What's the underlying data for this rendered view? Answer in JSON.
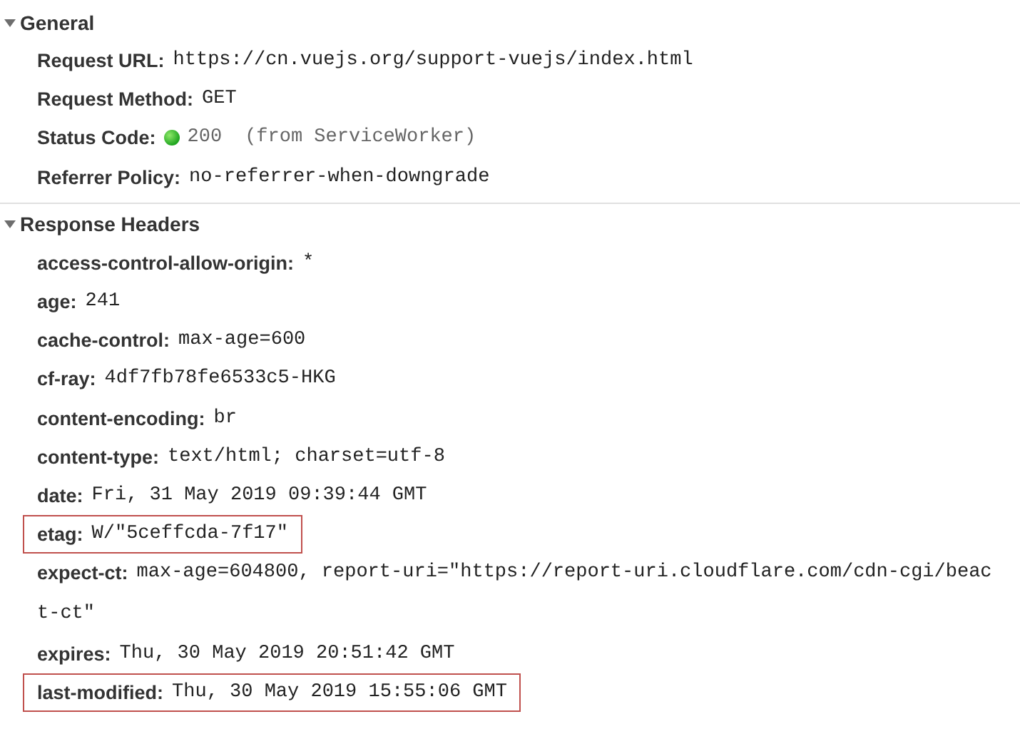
{
  "sections": [
    {
      "title": "General",
      "expanded": true,
      "rows": [
        {
          "kind": "plain",
          "name": "Request URL:",
          "value": "https://cn.vuejs.org/support-vuejs/index.html",
          "highlighted": false
        },
        {
          "kind": "plain",
          "name": "Request Method:",
          "value": "GET",
          "highlighted": false
        },
        {
          "kind": "status",
          "name": "Status Code:",
          "value": "200",
          "note": "(from ServiceWorker)",
          "highlighted": false
        },
        {
          "kind": "plain",
          "name": "Referrer Policy:",
          "value": "no-referrer-when-downgrade",
          "highlighted": false
        }
      ]
    },
    {
      "title": "Response Headers",
      "expanded": true,
      "rows": [
        {
          "kind": "plain",
          "name": "access-control-allow-origin:",
          "value": "*",
          "highlighted": false
        },
        {
          "kind": "plain",
          "name": "age:",
          "value": "241",
          "highlighted": false
        },
        {
          "kind": "plain",
          "name": "cache-control:",
          "value": "max-age=600",
          "highlighted": false
        },
        {
          "kind": "plain",
          "name": "cf-ray:",
          "value": "4df7fb78fe6533c5-HKG",
          "highlighted": false
        },
        {
          "kind": "plain",
          "name": "content-encoding:",
          "value": "br",
          "highlighted": false
        },
        {
          "kind": "plain",
          "name": "content-type:",
          "value": "text/html; charset=utf-8",
          "highlighted": false
        },
        {
          "kind": "plain",
          "name": "date:",
          "value": "Fri, 31 May 2019 09:39:44 GMT",
          "highlighted": false
        },
        {
          "kind": "plain",
          "name": "etag:",
          "value": "W/\"5ceffcda-7f17\"",
          "highlighted": true
        },
        {
          "kind": "wrapped",
          "name": "expect-ct:",
          "value": "max-age=604800, report-uri=\"https://report-uri.cloudflare.com/cdn-cgi/beac",
          "continuation": "t-ct\"",
          "highlighted": false
        },
        {
          "kind": "plain",
          "name": "expires:",
          "value": "Thu, 30 May 2019 20:51:42 GMT",
          "highlighted": false
        },
        {
          "kind": "plain",
          "name": "last-modified:",
          "value": "Thu, 30 May 2019 15:55:06 GMT",
          "highlighted": true
        }
      ]
    }
  ]
}
